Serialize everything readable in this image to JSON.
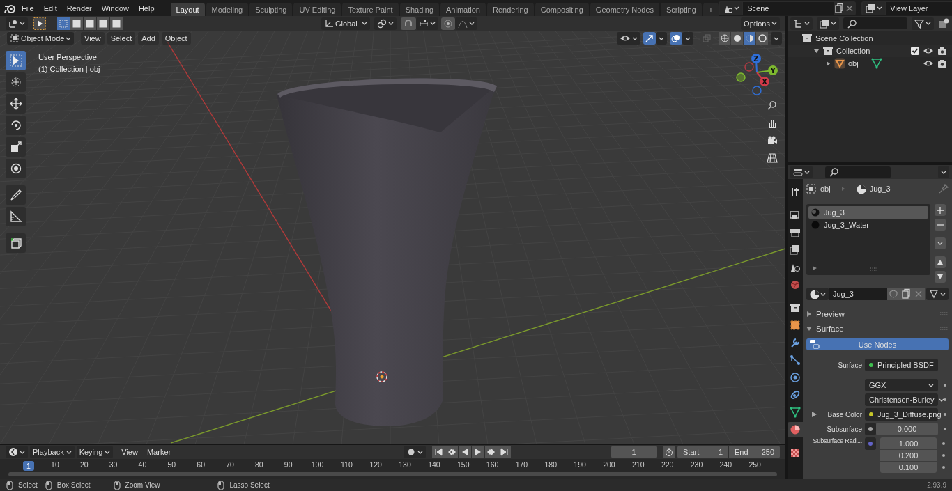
{
  "menu": [
    "File",
    "Edit",
    "Render",
    "Window",
    "Help"
  ],
  "workspaces": [
    {
      "label": "Layout",
      "selected": true
    },
    {
      "label": "Modeling",
      "selected": false
    },
    {
      "label": "Sculpting",
      "selected": false
    },
    {
      "label": "UV Editing",
      "selected": false
    },
    {
      "label": "Texture Paint",
      "selected": false
    },
    {
      "label": "Shading",
      "selected": false
    },
    {
      "label": "Animation",
      "selected": false
    },
    {
      "label": "Rendering",
      "selected": false
    },
    {
      "label": "Compositing",
      "selected": false
    },
    {
      "label": "Geometry Nodes",
      "selected": false
    },
    {
      "label": "Scripting",
      "selected": false
    }
  ],
  "add_workspace": "+",
  "scene": {
    "value": "Scene"
  },
  "view_layer": {
    "value": "View Layer"
  },
  "viewport": {
    "select_modes": [
      {
        "selected": true
      },
      {
        "selected": false
      },
      {
        "selected": false
      },
      {
        "selected": false
      },
      {
        "selected": false
      }
    ],
    "transform_orientation": "Global",
    "options": "Options",
    "mode": "Object Mode",
    "menus": [
      "View",
      "Select",
      "Add",
      "Object"
    ],
    "shading": [
      {
        "selected": false
      },
      {
        "selected": false
      },
      {
        "selected": true
      },
      {
        "selected": false
      }
    ],
    "view_name": "User Perspective",
    "collection_info": "(1) Collection | obj",
    "tools": [
      {
        "selected": true
      },
      {
        "selected": false
      },
      {
        "selected": false
      },
      {
        "selected": false
      },
      {
        "selected": false
      },
      {
        "selected": false
      },
      {
        "selected": false
      },
      {
        "selected": false
      },
      {
        "selected": false
      }
    ],
    "gizmo_axes": [
      "Z",
      "Y",
      "X"
    ]
  },
  "outliner": {
    "items": [
      {
        "label": "Scene Collection",
        "children": [
          {
            "label": "Collection",
            "expanded": true,
            "checked": true,
            "children": [
              {
                "label": "obj",
                "expanded": false
              }
            ]
          }
        ]
      }
    ]
  },
  "properties": {
    "tabs": [
      {
        "selected": false
      },
      {
        "selected": false
      },
      {
        "selected": false
      },
      {
        "selected": false
      },
      {
        "selected": false
      },
      {
        "selected": false
      },
      {
        "selected": false
      },
      {
        "selected": false
      },
      {
        "selected": false
      },
      {
        "selected": false
      },
      {
        "selected": false
      },
      {
        "selected": false
      },
      {
        "selected": false
      },
      {
        "selected": true
      },
      {
        "selected": false
      }
    ],
    "breadcrumb": [
      "obj",
      "Jug_3"
    ],
    "material_slots": [
      {
        "label": "Jug_3",
        "selected": true
      },
      {
        "label": "Jug_3_Water",
        "selected": false
      }
    ],
    "material_name": "Jug_3",
    "panels": [
      {
        "label": "Preview",
        "expanded": false
      },
      {
        "label": "Surface",
        "expanded": true
      }
    ],
    "use_nodes": "Use Nodes",
    "rows": [
      {
        "kind": "link",
        "label": "Surface",
        "value": "Principled BSDF",
        "color": "#3fbf4f"
      },
      {
        "kind": "dropdown",
        "value": "GGX"
      },
      {
        "kind": "dropdown",
        "value": "Christensen-Burley"
      },
      {
        "kind": "link",
        "label": "Base Color",
        "value": "Jug_3_Diffuse.png",
        "color": "#c7c729"
      },
      {
        "kind": "number",
        "label": "Subsurface",
        "value": "0.000",
        "color": "#a1a1a1"
      },
      {
        "kind": "vector",
        "label": "Subsurface Radi...",
        "values": [
          "1.000",
          "0.200",
          "0.100"
        ],
        "color": "#6363c7"
      }
    ]
  },
  "timeline": {
    "menus": [
      "Playback",
      "Keying",
      "View",
      "Marker"
    ],
    "current_frame": "1",
    "start_label": "Start",
    "start": "1",
    "end_label": "End",
    "end": "250",
    "playhead": "1",
    "ruler": [
      "10",
      "20",
      "30",
      "40",
      "50",
      "60",
      "70",
      "80",
      "90",
      "100",
      "110",
      "120",
      "130",
      "140",
      "150",
      "160",
      "170",
      "180",
      "190",
      "200",
      "210",
      "220",
      "230",
      "240",
      "250"
    ]
  },
  "status_bar": {
    "hints": [
      "Select",
      "Box Select",
      "Zoom View",
      "Lasso Select"
    ],
    "version": "2.93.9"
  }
}
